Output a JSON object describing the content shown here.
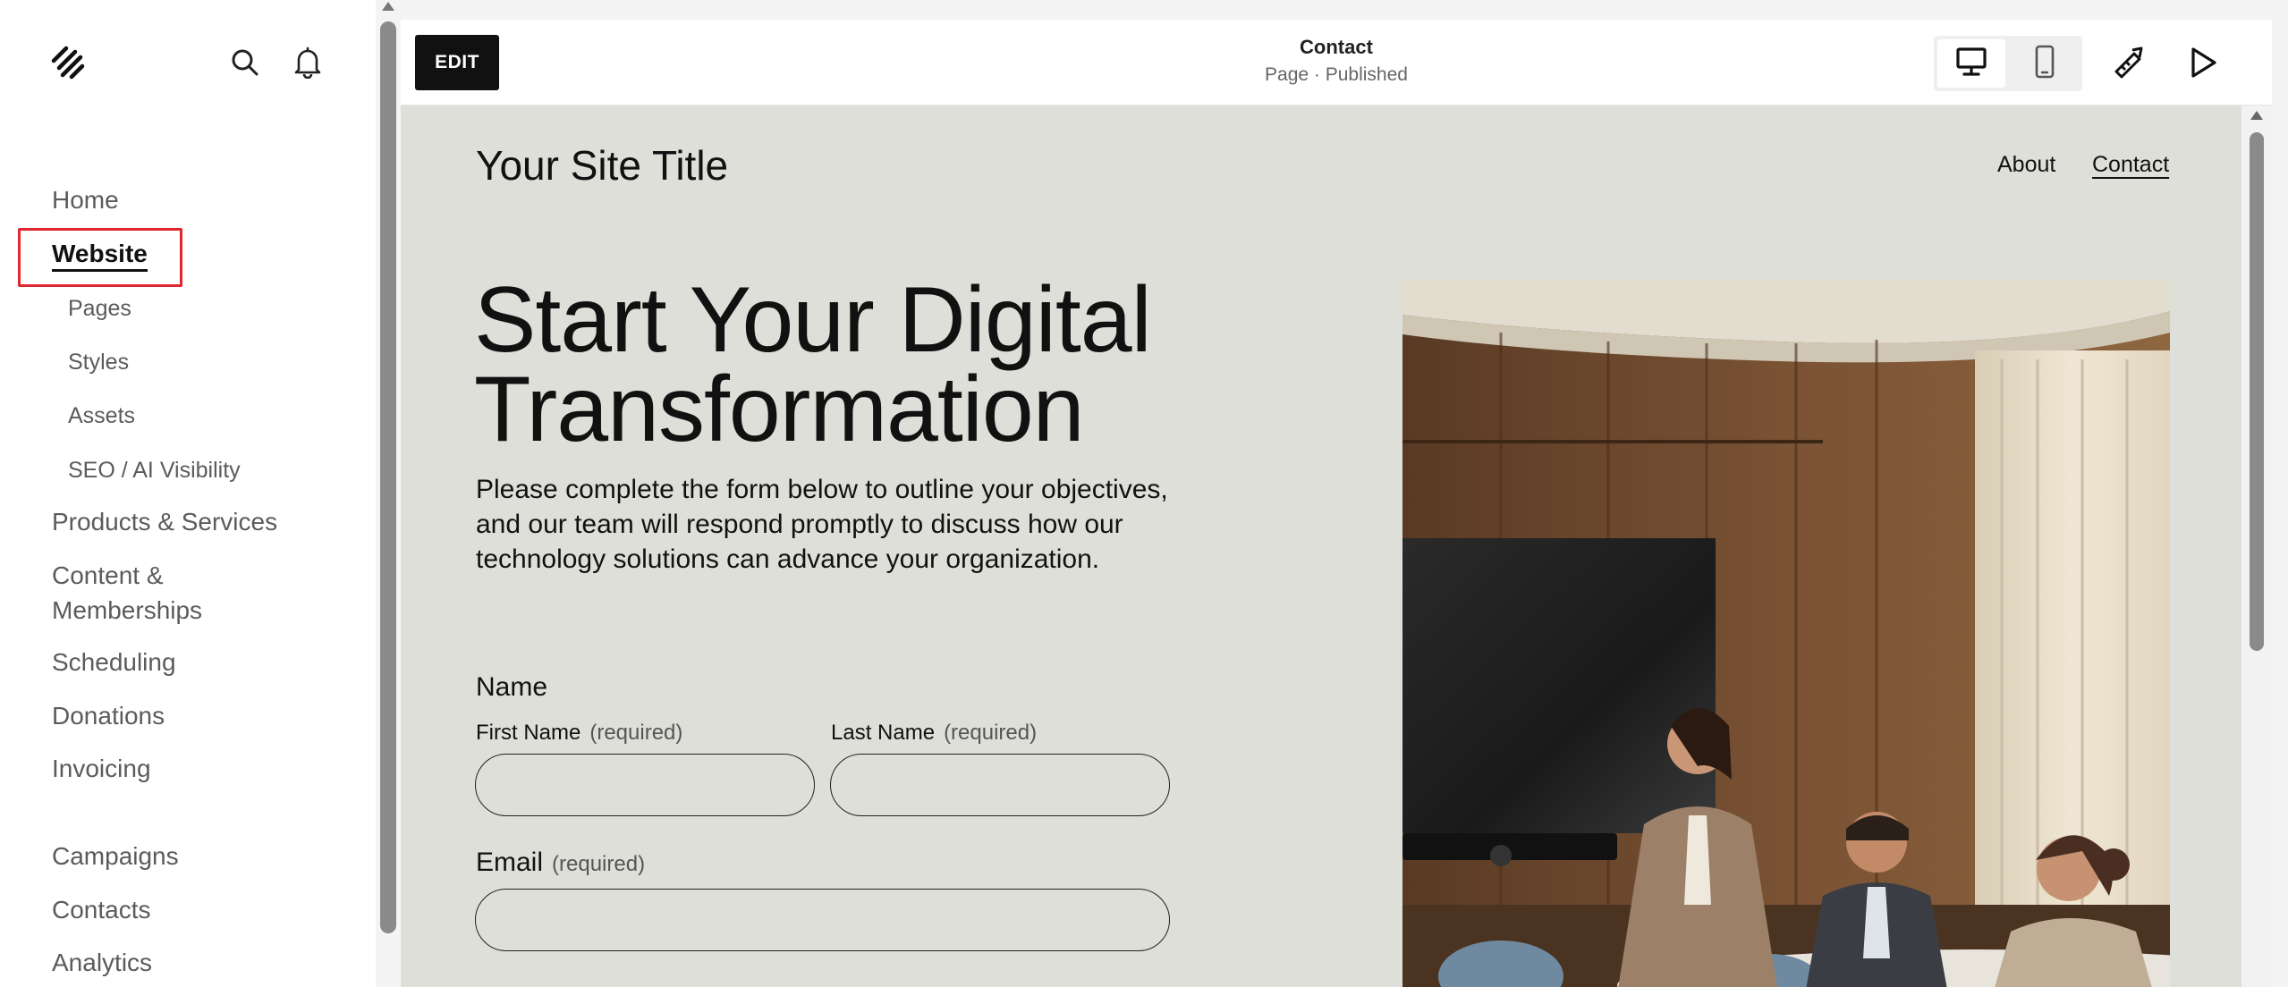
{
  "sidebar": {
    "nav": [
      {
        "label": "Home"
      },
      {
        "label": "Website",
        "active": true
      },
      {
        "label": "Pages",
        "sub": true
      },
      {
        "label": "Styles",
        "sub": true
      },
      {
        "label": "Assets",
        "sub": true
      },
      {
        "label": "SEO / AI Visibility",
        "sub": true
      },
      {
        "label": "Products & Services"
      },
      {
        "label": "Content &"
      },
      {
        "label": "Memberships"
      },
      {
        "label": "Scheduling"
      },
      {
        "label": "Donations"
      },
      {
        "label": "Invoicing"
      },
      {
        "label": "Campaigns"
      },
      {
        "label": "Contacts"
      },
      {
        "label": "Analytics"
      }
    ]
  },
  "topbar": {
    "edit_label": "EDIT",
    "page_title": "Contact",
    "page_status": "Page · Published"
  },
  "site": {
    "title": "Your Site Title",
    "nav": [
      {
        "label": "About"
      },
      {
        "label": "Contact",
        "current": true
      }
    ],
    "hero_heading_line1": "Start Your Digital",
    "hero_heading_line2": "Transformation",
    "hero_body": "Please complete the form below to outline your objectives, and our team will respond promptly to discuss how our technology solutions can advance your organization.",
    "form": {
      "name_label": "Name",
      "first_name_label": "First Name",
      "last_name_label": "Last Name",
      "required_text": "(required)",
      "email_label": "Email",
      "first_name_value": "",
      "last_name_value": "",
      "email_value": ""
    }
  },
  "colors": {
    "highlight": "#e0262f",
    "canvas_bg": "#dfdfd9",
    "edit_button_bg": "#111111"
  },
  "icons": {
    "logo": "squarespace-logo-icon",
    "search": "search-icon",
    "notifications": "bell-icon",
    "desktop": "desktop-icon",
    "mobile": "mobile-icon",
    "style": "design-tool-icon",
    "preview": "play-icon"
  }
}
